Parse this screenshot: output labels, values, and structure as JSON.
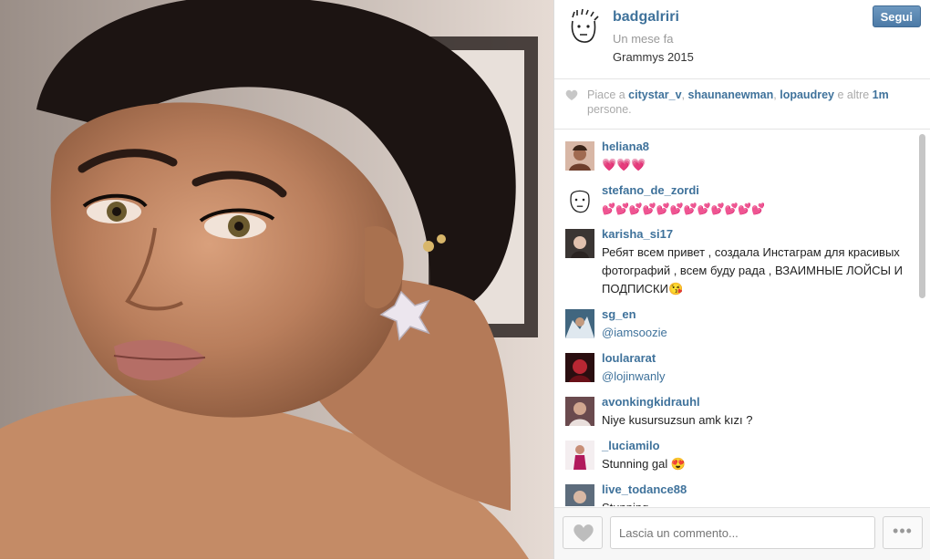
{
  "post": {
    "photo_alt": "",
    "username": "badgalriri",
    "time": "Un mese fa",
    "caption": "Grammys 2015",
    "follow_label": "Segui"
  },
  "likes": {
    "prefix": "Piace a ",
    "user1": "citystar_v",
    "sep1": ", ",
    "user2": "shaunanewman",
    "sep2": ", ",
    "user3": "lopaudrey",
    "middle": " e altre ",
    "count": "1m",
    "suffix": " persone."
  },
  "comments": [
    {
      "user": "heliana8",
      "text": "💗💗💗",
      "mention": false,
      "icon": "profile-photo"
    },
    {
      "user": "stefano_de_zordi",
      "text": "💕💕💕💕💕💕💕💕💕💕💕💕",
      "mention": false,
      "icon": "doodle-face"
    },
    {
      "user": "karisha_si17",
      "text": "Ребят всем привет , создала Инстаграм для красивых фотографий , всем буду рада , ВЗАИМНЫЕ ЛОЙСЫ И ПОДПИСКИ😘",
      "mention": false,
      "icon": "profile-photo"
    },
    {
      "user": "sg_en",
      "text": "@iamsoozie",
      "mention": true,
      "icon": "profile-photo"
    },
    {
      "user": "loulararat",
      "text": "@lojinwanly",
      "mention": true,
      "icon": "profile-photo"
    },
    {
      "user": "avonkingkidrauhl",
      "text": "Niye kusursuzsun amk kızı ?",
      "mention": false,
      "icon": "profile-photo"
    },
    {
      "user": "_luciamilo",
      "text": "Stunning gal 😍",
      "mention": false,
      "icon": "profile-photo"
    },
    {
      "user": "live_todance88",
      "text": "Stunning",
      "mention": false,
      "icon": "profile-photo"
    }
  ],
  "footer": {
    "comment_placeholder": "Lascia un commento...",
    "more_label": "•••"
  },
  "colors": {
    "link": "#3f729b",
    "follow_button": "#4c7aa6",
    "muted": "#999999"
  }
}
